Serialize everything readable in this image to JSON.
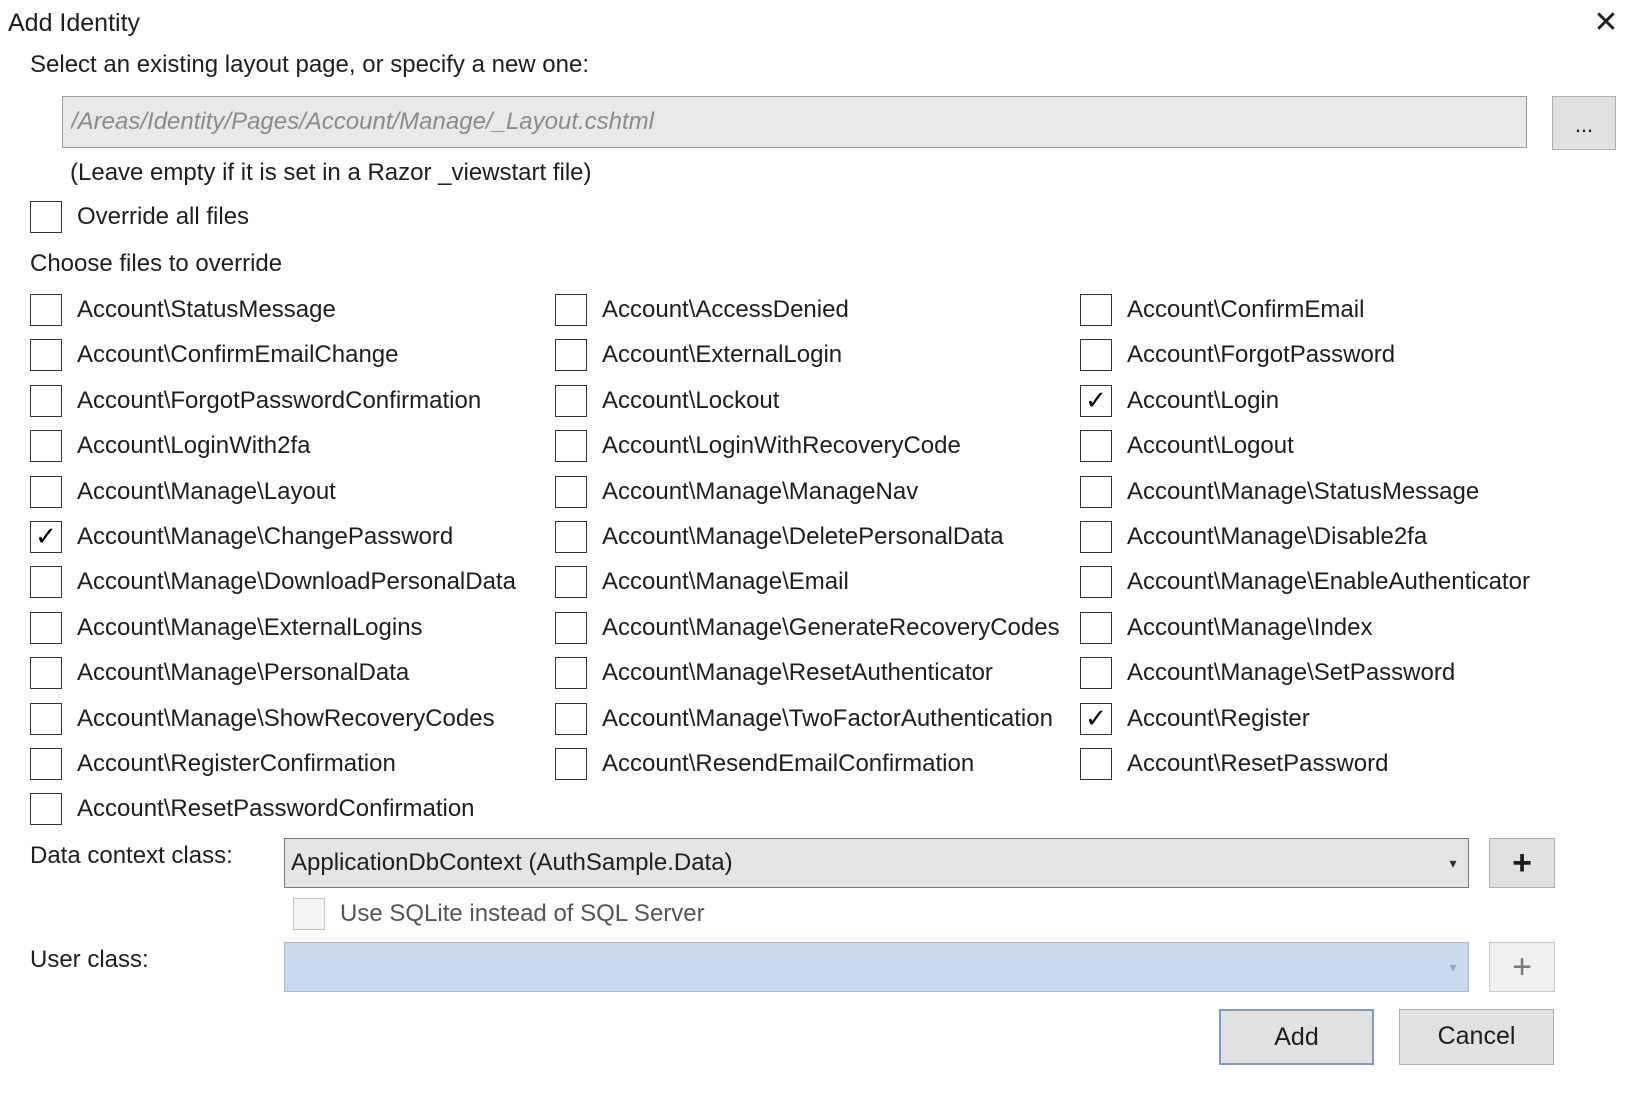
{
  "dialog": {
    "title": "Add Identity",
    "close_icon": "close-icon",
    "close_glyph": "✕"
  },
  "layout": {
    "prompt": "Select an existing layout page, or specify a new one:",
    "placeholder": "/Areas/Identity/Pages/Account/Manage/_Layout.cshtml",
    "value": "",
    "browse_label": "...",
    "hint": "(Leave empty if it is set in a Razor _viewstart file)"
  },
  "override_all": {
    "label": "Override all files",
    "checked": false
  },
  "choose_label": "Choose files to override",
  "check_glyph": "✓",
  "files": [
    {
      "label": "Account\\StatusMessage",
      "checked": false
    },
    {
      "label": "Account\\AccessDenied",
      "checked": false
    },
    {
      "label": "Account\\ConfirmEmail",
      "checked": false
    },
    {
      "label": "Account\\ConfirmEmailChange",
      "checked": false
    },
    {
      "label": "Account\\ExternalLogin",
      "checked": false
    },
    {
      "label": "Account\\ForgotPassword",
      "checked": false
    },
    {
      "label": "Account\\ForgotPasswordConfirmation",
      "checked": false
    },
    {
      "label": "Account\\Lockout",
      "checked": false
    },
    {
      "label": "Account\\Login",
      "checked": true
    },
    {
      "label": "Account\\LoginWith2fa",
      "checked": false
    },
    {
      "label": "Account\\LoginWithRecoveryCode",
      "checked": false
    },
    {
      "label": "Account\\Logout",
      "checked": false
    },
    {
      "label": "Account\\Manage\\Layout",
      "checked": false
    },
    {
      "label": "Account\\Manage\\ManageNav",
      "checked": false
    },
    {
      "label": "Account\\Manage\\StatusMessage",
      "checked": false
    },
    {
      "label": "Account\\Manage\\ChangePassword",
      "checked": true
    },
    {
      "label": "Account\\Manage\\DeletePersonalData",
      "checked": false
    },
    {
      "label": "Account\\Manage\\Disable2fa",
      "checked": false
    },
    {
      "label": "Account\\Manage\\DownloadPersonalData",
      "checked": false
    },
    {
      "label": "Account\\Manage\\Email",
      "checked": false
    },
    {
      "label": "Account\\Manage\\EnableAuthenticator",
      "checked": false
    },
    {
      "label": "Account\\Manage\\ExternalLogins",
      "checked": false
    },
    {
      "label": "Account\\Manage\\GenerateRecoveryCodes",
      "checked": false
    },
    {
      "label": "Account\\Manage\\Index",
      "checked": false
    },
    {
      "label": "Account\\Manage\\PersonalData",
      "checked": false
    },
    {
      "label": "Account\\Manage\\ResetAuthenticator",
      "checked": false
    },
    {
      "label": "Account\\Manage\\SetPassword",
      "checked": false
    },
    {
      "label": "Account\\Manage\\ShowRecoveryCodes",
      "checked": false
    },
    {
      "label": "Account\\Manage\\TwoFactorAuthentication",
      "checked": false
    },
    {
      "label": "Account\\Register",
      "checked": true
    },
    {
      "label": "Account\\RegisterConfirmation",
      "checked": false
    },
    {
      "label": "Account\\ResendEmailConfirmation",
      "checked": false
    },
    {
      "label": "Account\\ResetPassword",
      "checked": false
    },
    {
      "label": "Account\\ResetPasswordConfirmation",
      "checked": false
    }
  ],
  "data_context": {
    "label": "Data context class:",
    "value": "ApplicationDbContext (AuthSample.Data)",
    "add_label": "+",
    "arrow_glyph": "▾"
  },
  "sqlite": {
    "label": "Use SQLite instead of SQL Server",
    "checked": false,
    "enabled": false
  },
  "user_class": {
    "label": "User class:",
    "value": "",
    "add_label": "+",
    "arrow_glyph": "▾",
    "enabled": false
  },
  "buttons": {
    "add": "Add",
    "cancel": "Cancel"
  }
}
